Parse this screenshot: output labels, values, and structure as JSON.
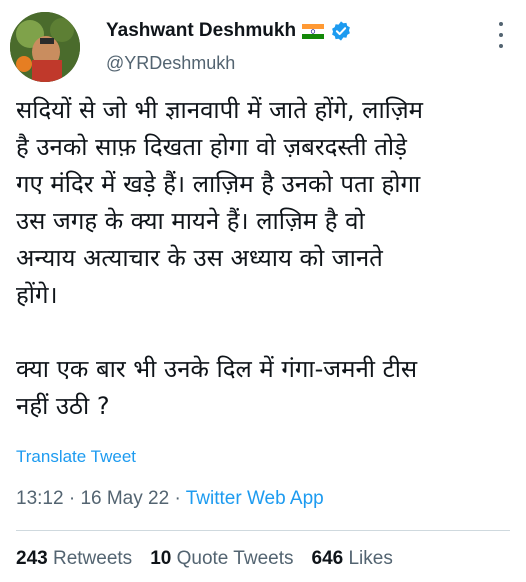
{
  "header": {
    "display_name": "Yashwant Deshmukh",
    "handle": "@YRDeshmukh",
    "flag_icon": "india-flag-icon",
    "verified_icon": "verified-badge-icon",
    "more_icon": "more-options-icon"
  },
  "tweet": {
    "text": "सदियों से जो भी ज्ञानवापी में जाते होंगे, लाज़िम\nहै उनको साफ़ दिखता होगा वो ज़बरदस्ती तोड़े\nगए मंदिर में खड़े हैं। लाज़िम है उनको पता होगा\nउस जगह के क्या मायने हैं। लाज़िम है वो\nअन्याय अत्याचार के उस अध्याय को जानते\nहोंगे।\n\nक्या एक बार भी उनके दिल में गंगा-जमनी टीस\nनहीं उठी ?",
    "translate_label": "Translate Tweet"
  },
  "meta": {
    "time": "13:12",
    "separator": "·",
    "date": "16 May 22",
    "app": "Twitter Web App"
  },
  "stats": {
    "retweets_count": "243",
    "retweets_label": "Retweets",
    "quotes_count": "10",
    "quotes_label": "Quote Tweets",
    "likes_count": "646",
    "likes_label": "Likes"
  },
  "colors": {
    "link": "#1d9bf0",
    "secondary_text": "#536471",
    "primary_text": "#0f1419"
  }
}
